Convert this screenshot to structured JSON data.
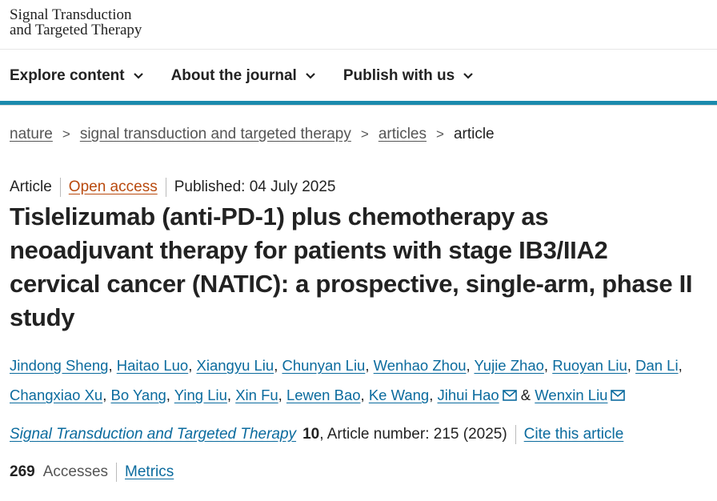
{
  "journal_logo": {
    "line1": "Signal Transduction",
    "line2": "and Targeted Therapy"
  },
  "nav": [
    {
      "label": "Explore content",
      "icon": "chevron-down-icon"
    },
    {
      "label": "About the journal",
      "icon": "chevron-down-icon"
    },
    {
      "label": "Publish with us",
      "icon": "chevron-down-icon"
    }
  ],
  "breadcrumb": {
    "items": [
      "nature",
      "signal transduction and targeted therapy",
      "articles"
    ],
    "current": "article",
    "separator": ">"
  },
  "article_meta": {
    "type": "Article",
    "access": "Open access",
    "published": "Published: 04 July 2025"
  },
  "title": "Tislelizumab (anti-PD-1) plus chemotherapy as neoadjuvant therapy for patients with stage IB3/IIA2 cervical cancer (NATIC): a prospective, single-arm, phase II study",
  "authors": {
    "line1": [
      "Jindong Sheng",
      "Haitao Luo",
      "Xiangyu Liu",
      "Chunyan Liu",
      "Wenhao Zhou",
      "Yujie Zhao",
      "Ruoyan Liu",
      "Dan Li"
    ],
    "line2": [
      "Changxiao Xu",
      "Bo Yang",
      "Ying Liu",
      "Xin Fu",
      "Lewen Bao",
      "Ke Wang"
    ],
    "corresponding": [
      "Jihui Hao",
      "Wenxin Liu"
    ],
    "and_sign": "&",
    "comma": ","
  },
  "citation": {
    "journal": "Signal Transduction and Targeted Therapy",
    "volume": "10",
    "rest": ", Article number: 215 (2025)",
    "cite_link": "Cite this article"
  },
  "metrics": {
    "count": "269",
    "label": "Accesses",
    "link": "Metrics"
  },
  "colors": {
    "accent_bar": "#1b8aad",
    "link": "#0b6b9e",
    "open_access": "#b94a0e"
  }
}
